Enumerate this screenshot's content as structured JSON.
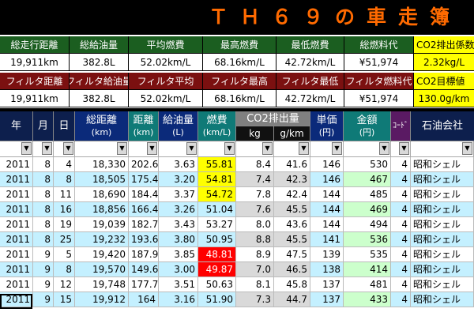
{
  "title": "ＴＨ６９の車走簿",
  "summary_top": {
    "labels": [
      "総走行距離",
      "総給油量",
      "平均燃費",
      "最高燃費",
      "最低燃費",
      "総燃料代",
      "CO2排出係数"
    ],
    "values": [
      "19,911km",
      "382.8L",
      "52.02km/L",
      "68.16km/L",
      "42.72km/L",
      "¥51,974",
      "2.32kg/L"
    ]
  },
  "summary_filter": {
    "labels": [
      "フィルタ距離",
      "フィルタ給油量",
      "フィルタ平均",
      "フィルタ最高",
      "フィルタ最低",
      "フィルタ燃料代",
      "CO2目標値"
    ],
    "values": [
      "19,911km",
      "382.8L",
      "52.02km/L",
      "68.16km/L",
      "42.72km/L",
      "¥51,974",
      "130.0g/km"
    ]
  },
  "table_headers": {
    "year": "年",
    "month": "月",
    "day": "日",
    "total_distance": "総距離",
    "total_distance_unit": "(km)",
    "distance": "距離",
    "distance_unit": "(km)",
    "fuel": "給油量",
    "fuel_unit": "(L)",
    "economy": "燃費",
    "economy_unit": "(km/L)",
    "co2": "CO2排出量",
    "co2_kg": "kg",
    "co2_gkm": "g/km",
    "unit_price": "単価",
    "unit_price_unit": "(円)",
    "amount": "金額",
    "amount_unit": "(円)",
    "code": "ｺｰﾄﾞ",
    "company": "石油会社"
  },
  "filter_icon": "dropdown-arrow-icon",
  "filter_glyph": "▼",
  "rows": [
    {
      "year": "2011",
      "month": "8",
      "day": "4",
      "total": "18,330",
      "dist": "202.6",
      "fuel": "3.63",
      "econ": "55.81",
      "econ_flag": "yellow",
      "kg": "8.4",
      "gkm": "41.6",
      "price": "146",
      "amount": "530",
      "code": "4",
      "company": "昭和シェル",
      "style": "white"
    },
    {
      "year": "2011",
      "month": "8",
      "day": "8",
      "total": "18,505",
      "dist": "175.4",
      "fuel": "3.20",
      "econ": "54.81",
      "econ_flag": "yellow",
      "kg": "7.4",
      "gkm": "42.3",
      "price": "146",
      "amount": "467",
      "code": "4",
      "company": "昭和シェル",
      "style": "blue"
    },
    {
      "year": "2011",
      "month": "8",
      "day": "11",
      "total": "18,690",
      "dist": "184.4",
      "fuel": "3.37",
      "econ": "54.72",
      "econ_flag": "yellow",
      "kg": "7.8",
      "gkm": "42.4",
      "price": "144",
      "amount": "485",
      "code": "4",
      "company": "昭和シェル",
      "style": "white"
    },
    {
      "year": "2011",
      "month": "8",
      "day": "16",
      "total": "18,856",
      "dist": "166.4",
      "fuel": "3.26",
      "econ": "51.04",
      "econ_flag": "",
      "kg": "7.6",
      "gkm": "45.5",
      "price": "144",
      "amount": "469",
      "code": "4",
      "company": "昭和シェル",
      "style": "blue"
    },
    {
      "year": "2011",
      "month": "8",
      "day": "19",
      "total": "19,039",
      "dist": "182.7",
      "fuel": "3.43",
      "econ": "53.27",
      "econ_flag": "",
      "kg": "8.0",
      "gkm": "43.6",
      "price": "144",
      "amount": "494",
      "code": "4",
      "company": "昭和シェル",
      "style": "white"
    },
    {
      "year": "2011",
      "month": "8",
      "day": "25",
      "total": "19,232",
      "dist": "193.6",
      "fuel": "3.80",
      "econ": "50.95",
      "econ_flag": "",
      "kg": "8.8",
      "gkm": "45.5",
      "price": "141",
      "amount": "536",
      "code": "4",
      "company": "昭和シェル",
      "style": "blue"
    },
    {
      "year": "2011",
      "month": "9",
      "day": "5",
      "total": "19,420",
      "dist": "187.9",
      "fuel": "3.85",
      "econ": "48.81",
      "econ_flag": "red",
      "kg": "8.9",
      "gkm": "47.5",
      "price": "139",
      "amount": "535",
      "code": "4",
      "company": "昭和シェル",
      "style": "white"
    },
    {
      "year": "2011",
      "month": "9",
      "day": "8",
      "total": "19,570",
      "dist": "149.6",
      "fuel": "3.00",
      "econ": "49.87",
      "econ_flag": "red",
      "kg": "7.0",
      "gkm": "46.5",
      "price": "138",
      "amount": "414",
      "code": "4",
      "company": "昭和シェル",
      "style": "blue"
    },
    {
      "year": "2011",
      "month": "9",
      "day": "12",
      "total": "19,748",
      "dist": "177.7",
      "fuel": "3.51",
      "econ": "50.63",
      "econ_flag": "",
      "kg": "8.1",
      "gkm": "45.8",
      "price": "137",
      "amount": "481",
      "code": "4",
      "company": "昭和シェル",
      "style": "white"
    },
    {
      "year": "2011",
      "month": "9",
      "day": "15",
      "total": "19,912",
      "dist": "164",
      "fuel": "3.16",
      "econ": "51.90",
      "econ_flag": "",
      "kg": "7.3",
      "gkm": "44.7",
      "price": "137",
      "amount": "433",
      "code": "4",
      "company": "昭和シェル",
      "style": "blue"
    }
  ]
}
